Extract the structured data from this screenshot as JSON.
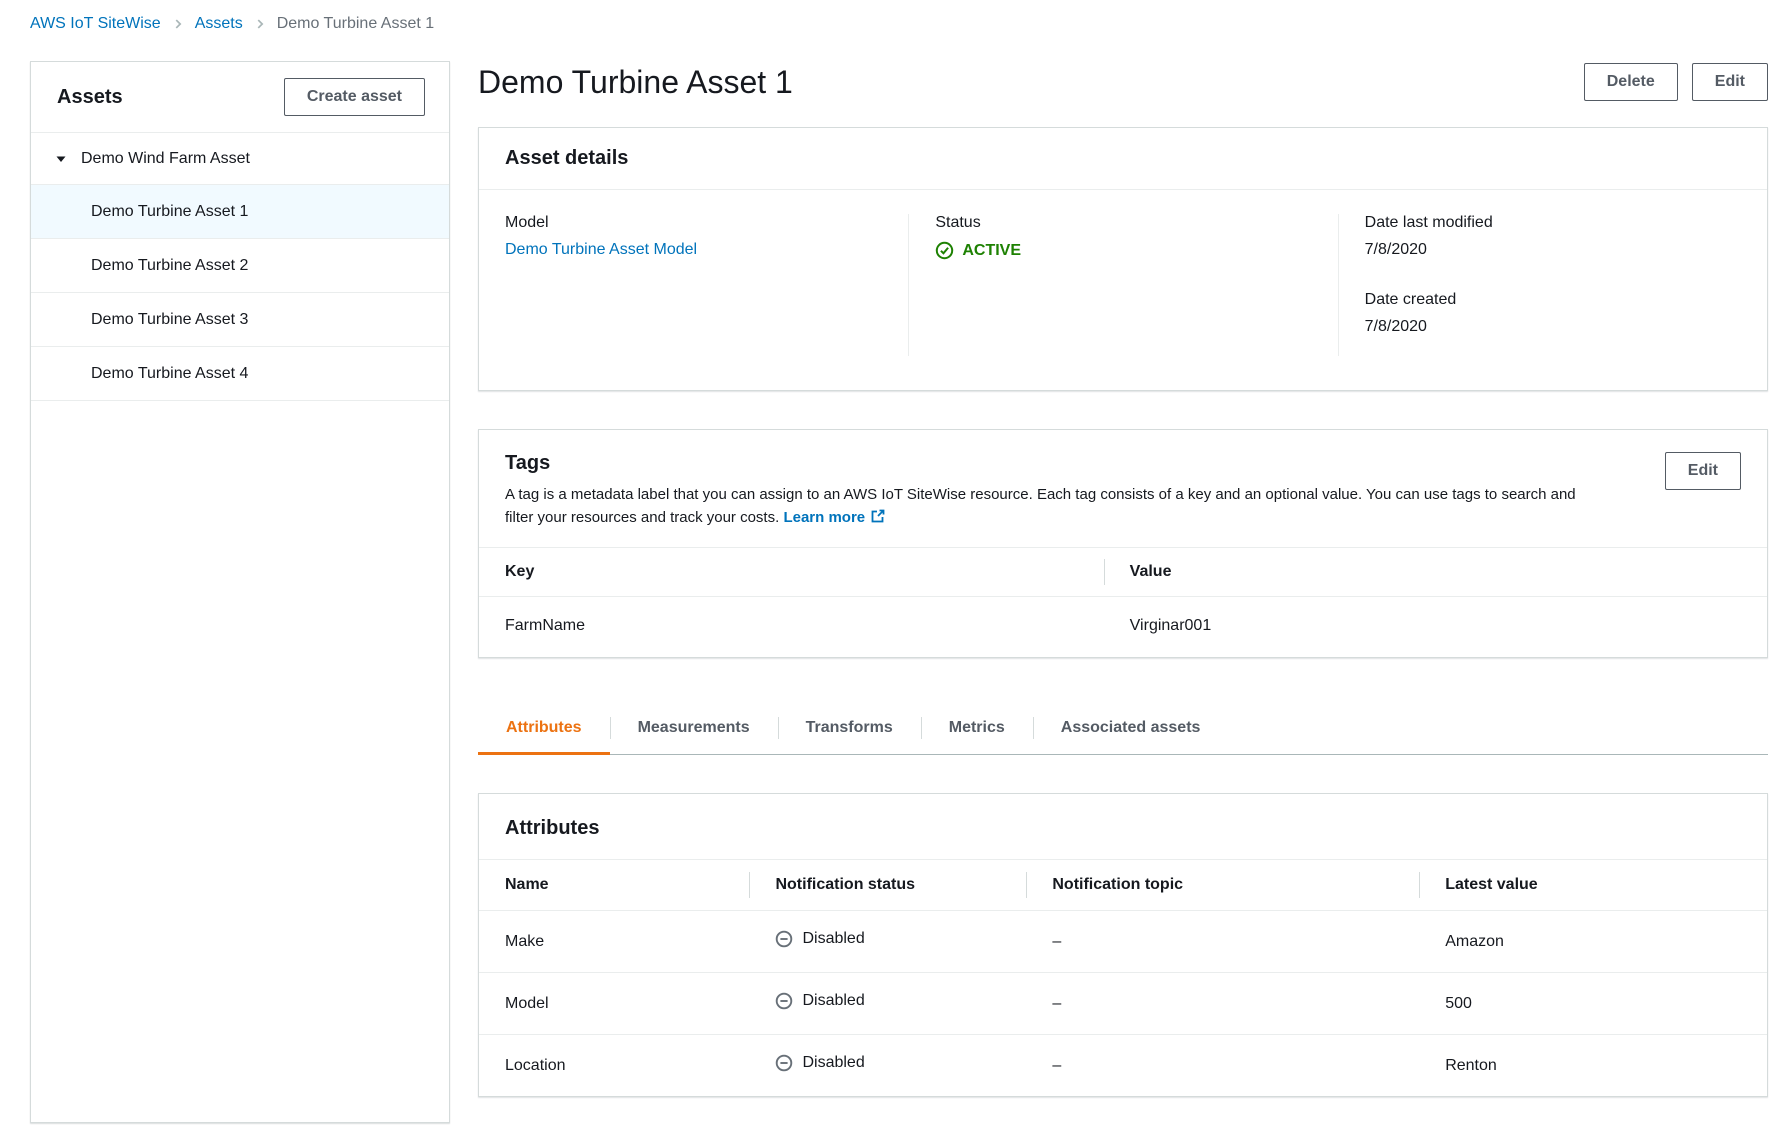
{
  "breadcrumb": {
    "items": [
      "AWS IoT SiteWise",
      "Assets",
      "Demo Turbine Asset 1"
    ]
  },
  "sidebar": {
    "title": "Assets",
    "create_button": "Create asset",
    "tree": {
      "root": "Demo Wind Farm Asset",
      "children": [
        "Demo Turbine Asset 1",
        "Demo Turbine Asset 2",
        "Demo Turbine Asset 3",
        "Demo Turbine Asset 4"
      ],
      "selected": "Demo Turbine Asset 1"
    }
  },
  "header": {
    "title": "Demo Turbine Asset 1",
    "delete_button": "Delete",
    "edit_button": "Edit"
  },
  "asset_details": {
    "title": "Asset details",
    "model_label": "Model",
    "model_value": "Demo Turbine Asset Model",
    "status_label": "Status",
    "status_value": "ACTIVE",
    "date_modified_label": "Date last modified",
    "date_modified_value": "7/8/2020",
    "date_created_label": "Date created",
    "date_created_value": "7/8/2020"
  },
  "tags": {
    "title": "Tags",
    "edit_button": "Edit",
    "description": "A tag is a metadata label that you can assign to an AWS IoT SiteWise resource. Each tag consists of a key and an optional value. You can use tags to search and filter your resources and track your costs.",
    "learn_more": "Learn more",
    "columns": {
      "key": "Key",
      "value": "Value"
    },
    "rows": [
      {
        "key": "FarmName",
        "value": "Virginar001"
      }
    ]
  },
  "tabs": {
    "items": [
      "Attributes",
      "Measurements",
      "Transforms",
      "Metrics",
      "Associated assets"
    ],
    "active": "Attributes"
  },
  "attributes": {
    "title": "Attributes",
    "columns": {
      "name": "Name",
      "notification_status": "Notification status",
      "notification_topic": "Notification topic",
      "latest_value": "Latest value"
    },
    "rows": [
      {
        "name": "Make",
        "notification_status": "Disabled",
        "notification_topic": "–",
        "latest_value": "Amazon"
      },
      {
        "name": "Model",
        "notification_status": "Disabled",
        "notification_topic": "–",
        "latest_value": "500"
      },
      {
        "name": "Location",
        "notification_status": "Disabled",
        "notification_topic": "–",
        "latest_value": "Renton"
      }
    ]
  },
  "icons": {
    "breadcrumb_separator": "chevron-right-icon",
    "tree_expanded": "caret-down-icon",
    "status_active": "check-circle-icon",
    "notification_disabled": "minus-circle-icon",
    "learn_more_external": "external-link-icon"
  },
  "colors": {
    "link_blue": "#0073bb",
    "active_green": "#1d8102",
    "tab_orange": "#ec7211",
    "text_primary": "#16191f",
    "text_secondary": "#545b64",
    "border_card": "#d5dbdb",
    "border_row": "#eaeded",
    "selected_row_bg": "#f1faff"
  }
}
